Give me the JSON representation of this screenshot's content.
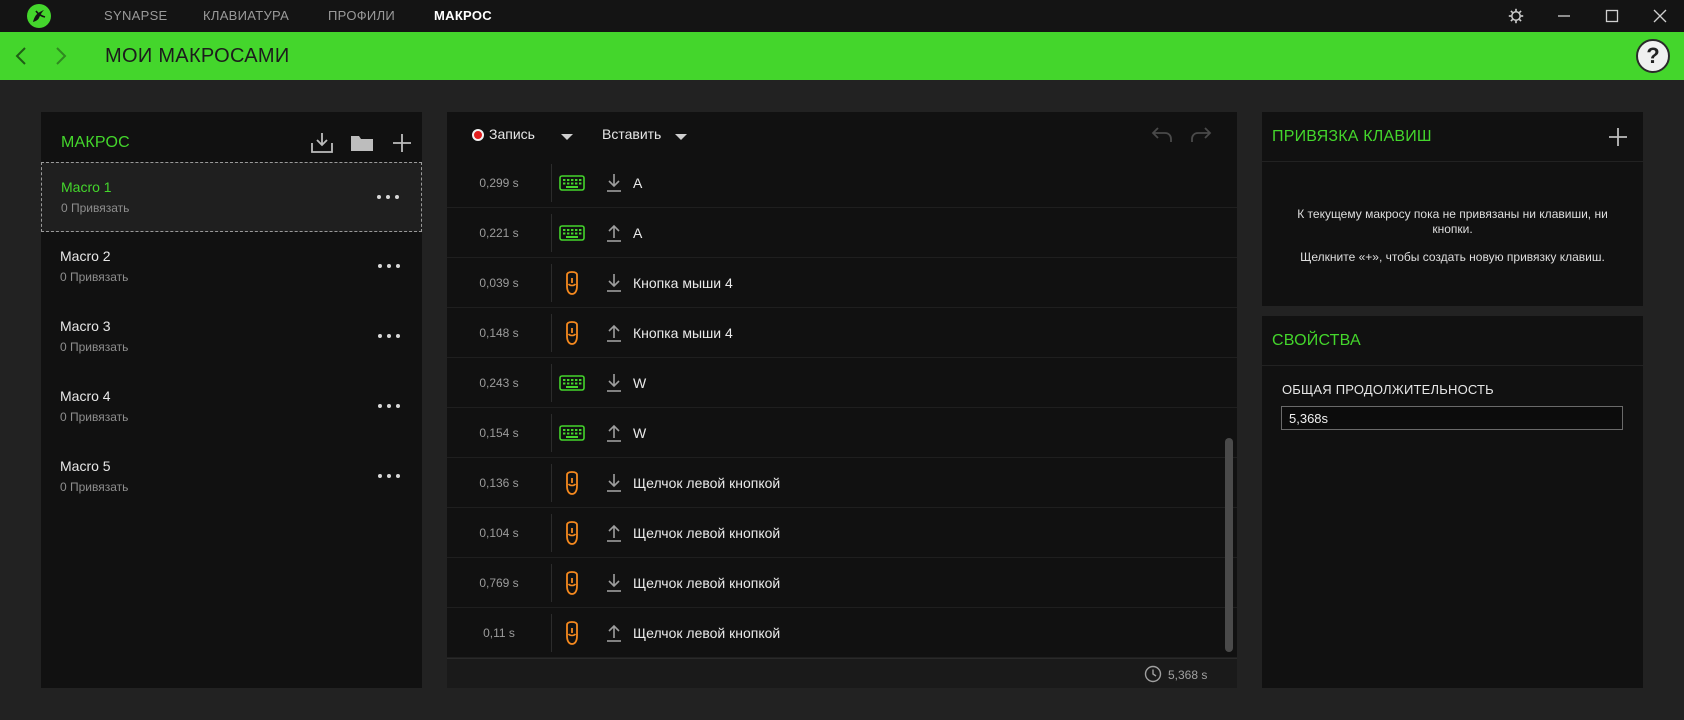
{
  "titlebar": {
    "tabs": [
      "SYNAPSE",
      "КЛАВИАТУРА",
      "ПРОФИЛИ",
      "МАКРОС"
    ],
    "active_tab": "МАКРОС"
  },
  "header": {
    "title": "МОИ МАКРОСАМИ",
    "help": "?"
  },
  "colors": {
    "accent": "#44d62c",
    "keyboard_icon": "#44d62c",
    "mouse_icon": "#f5891f",
    "record": "#e21d1d"
  },
  "macros_panel": {
    "title": "МАКРОС",
    "items": [
      {
        "name": "Macro 1",
        "sub": "0 Привязать",
        "selected": true
      },
      {
        "name": "Macro 2",
        "sub": "0 Привязать",
        "selected": false
      },
      {
        "name": "Macro 3",
        "sub": "0 Привязать",
        "selected": false
      },
      {
        "name": "Macro 4",
        "sub": "0 Привязать",
        "selected": false
      },
      {
        "name": "Macro 5",
        "sub": "0 Привязать",
        "selected": false
      }
    ]
  },
  "editor": {
    "record_label": "Запись",
    "insert_label": "Вставить",
    "events": [
      {
        "time": "0,299 s",
        "device": "keyboard",
        "dir": "down",
        "label": "A"
      },
      {
        "time": "0,221 s",
        "device": "keyboard",
        "dir": "up",
        "label": "A"
      },
      {
        "time": "0,039 s",
        "device": "mouse",
        "dir": "down",
        "label": "Кнопка мыши 4"
      },
      {
        "time": "0,148 s",
        "device": "mouse",
        "dir": "up",
        "label": "Кнопка мыши 4"
      },
      {
        "time": "0,243 s",
        "device": "keyboard",
        "dir": "down",
        "label": "W"
      },
      {
        "time": "0,154 s",
        "device": "keyboard",
        "dir": "up",
        "label": "W"
      },
      {
        "time": "0,136 s",
        "device": "mouse",
        "dir": "down",
        "label": "Щелчок левой кнопкой"
      },
      {
        "time": "0,104 s",
        "device": "mouse",
        "dir": "up",
        "label": "Щелчок левой кнопкой"
      },
      {
        "time": "0,769 s",
        "device": "mouse",
        "dir": "down",
        "label": "Щелчок левой кнопкой"
      },
      {
        "time": "0,11 s",
        "device": "mouse",
        "dir": "up",
        "label": "Щелчок левой кнопкой"
      }
    ],
    "total_time": "5,368 s"
  },
  "binding_panel": {
    "title": "ПРИВЯЗКА КЛАВИШ",
    "message_1": "К текущему макросу пока не привязаны ни клавиши, ни кнопки.",
    "message_2": "Щелкните «+», чтобы создать новую привязку клавиш."
  },
  "properties_panel": {
    "title": "СВОЙСТВА",
    "duration_label": "ОБЩАЯ ПРОДОЛЖИТЕЛЬНОСТЬ",
    "duration_value": "5,368s"
  }
}
